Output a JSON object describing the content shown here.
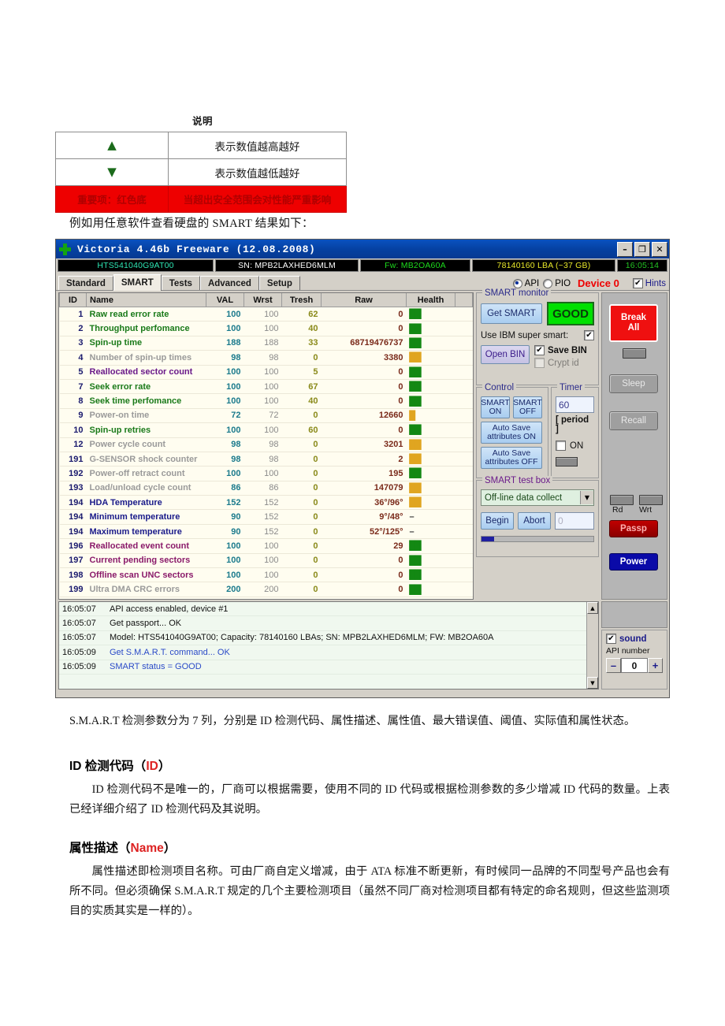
{
  "legend": {
    "title": "说明",
    "rows": [
      {
        "mark": "▲",
        "desc": "表示数值越高越好",
        "type": "up"
      },
      {
        "mark": "▼",
        "desc": "表示数值越低越好",
        "type": "down"
      },
      {
        "mark": "重要项：红色底",
        "desc": "当超出安全范围会对性能严重影响",
        "type": "warn"
      }
    ]
  },
  "intro": "例如用任意软件查看硬盘的 SMART 结果如下：",
  "victoria": {
    "title": "Victoria 4.46b Freeware (12.08.2008)",
    "window_buttons": {
      "minimize": "–",
      "maximize": "❐",
      "close": "✕"
    },
    "info": {
      "model": "HTS541040G9AT00",
      "sn": "SN: MPB2LAXHED6MLM",
      "fw": "Fw: MB2OA60A",
      "lba": "78140160 LBA (~37 GB)",
      "clock": "16:05:14"
    },
    "tabs": [
      {
        "label": "Standard",
        "active": false
      },
      {
        "label": "SMART",
        "active": true
      },
      {
        "label": "Tests",
        "active": false
      },
      {
        "label": "Advanced",
        "active": false
      },
      {
        "label": "Setup",
        "active": false
      }
    ],
    "mode": {
      "api": "API",
      "pio": "PIO",
      "api_selected": true,
      "device": "Device 0",
      "hints": "Hints",
      "hints_checked": true
    },
    "table": {
      "headers": [
        "ID",
        "Name",
        "VAL",
        "Wrst",
        "Tresh",
        "Raw",
        "Health"
      ],
      "rows": [
        {
          "id": "1",
          "name": "Raw read error rate",
          "name_color": "n-green",
          "val": "100",
          "wrst": "100",
          "tresh": "62",
          "raw": "0",
          "raw_color": "",
          "health": "▉▉",
          "health_color": "h-green"
        },
        {
          "id": "2",
          "name": "Throughput perfomance",
          "name_color": "n-green",
          "val": "100",
          "wrst": "100",
          "tresh": "40",
          "raw": "0",
          "raw_color": "",
          "health": "▉▉",
          "health_color": "h-green"
        },
        {
          "id": "3",
          "name": "Spin-up time",
          "name_color": "n-green",
          "val": "188",
          "wrst": "188",
          "tresh": "33",
          "raw": "68719476737",
          "raw_color": "",
          "health": "▉▉",
          "health_color": "h-green"
        },
        {
          "id": "4",
          "name": "Number of spin-up times",
          "name_color": "n-gray",
          "val": "98",
          "wrst": "98",
          "tresh": "0",
          "raw": "3380",
          "raw_color": "",
          "health": "▉▉",
          "health_color": "h-amber"
        },
        {
          "id": "5",
          "name": "Reallocated sector count",
          "name_color": "n-purple",
          "val": "100",
          "wrst": "100",
          "tresh": "5",
          "raw": "0",
          "raw_color": "",
          "health": "▉▉",
          "health_color": "h-green"
        },
        {
          "id": "7",
          "name": "Seek error rate",
          "name_color": "n-green",
          "val": "100",
          "wrst": "100",
          "tresh": "67",
          "raw": "0",
          "raw_color": "",
          "health": "▉▉",
          "health_color": "h-green"
        },
        {
          "id": "8",
          "name": "Seek time perfomance",
          "name_color": "n-green",
          "val": "100",
          "wrst": "100",
          "tresh": "40",
          "raw": "0",
          "raw_color": "",
          "health": "▉▉",
          "health_color": "h-green"
        },
        {
          "id": "9",
          "name": "Power-on time",
          "name_color": "n-gray",
          "val": "72",
          "wrst": "72",
          "tresh": "0",
          "raw": "12660",
          "raw_color": "",
          "health": "▉",
          "health_color": "h-amber"
        },
        {
          "id": "10",
          "name": "Spin-up retries",
          "name_color": "n-green",
          "val": "100",
          "wrst": "100",
          "tresh": "60",
          "raw": "0",
          "raw_color": "",
          "health": "▉▉",
          "health_color": "h-green"
        },
        {
          "id": "12",
          "name": "Power cycle count",
          "name_color": "n-gray",
          "val": "98",
          "wrst": "98",
          "tresh": "0",
          "raw": "3201",
          "raw_color": "",
          "health": "▉▉",
          "health_color": "h-amber"
        },
        {
          "id": "191",
          "name": "G-SENSOR shock counter",
          "name_color": "n-gray",
          "val": "98",
          "wrst": "98",
          "tresh": "0",
          "raw": "2",
          "raw_color": "",
          "health": "▉▉",
          "health_color": "h-amber"
        },
        {
          "id": "192",
          "name": "Power-off retract count",
          "name_color": "n-gray",
          "val": "100",
          "wrst": "100",
          "tresh": "0",
          "raw": "195",
          "raw_color": "",
          "health": "▉▉",
          "health_color": "h-green"
        },
        {
          "id": "193",
          "name": "Load/unload cycle count",
          "name_color": "n-gray",
          "val": "86",
          "wrst": "86",
          "tresh": "0",
          "raw": "147079",
          "raw_color": "",
          "health": "▉▉",
          "health_color": "h-amber"
        },
        {
          "id": "194",
          "name": "HDA Temperature",
          "name_color": "n-navy",
          "val": "152",
          "wrst": "152",
          "tresh": "0",
          "raw": "36°/96°",
          "raw_color": "raw-navy",
          "health": "▉▉",
          "health_color": "h-amber"
        },
        {
          "id": "194",
          "name": "Minimum temperature",
          "name_color": "n-navy",
          "val": "90",
          "wrst": "152",
          "tresh": "0",
          "raw": "9°/48°",
          "raw_color": "raw-navy",
          "health": "–",
          "health_color": "h-dash"
        },
        {
          "id": "194",
          "name": "Maximum temperature",
          "name_color": "n-navy",
          "val": "90",
          "wrst": "152",
          "tresh": "0",
          "raw": "52°/125°",
          "raw_color": "raw-navy",
          "health": "–",
          "health_color": "h-dash"
        },
        {
          "id": "196",
          "name": "Reallocated event count",
          "name_color": "n-magenta",
          "val": "100",
          "wrst": "100",
          "tresh": "0",
          "raw": "29",
          "raw_color": "raw-red",
          "health": "▉▉",
          "health_color": "h-green"
        },
        {
          "id": "197",
          "name": "Current pending sectors",
          "name_color": "n-magenta",
          "val": "100",
          "wrst": "100",
          "tresh": "0",
          "raw": "0",
          "raw_color": "",
          "health": "▉▉",
          "health_color": "h-green"
        },
        {
          "id": "198",
          "name": "Offline scan UNC sectors",
          "name_color": "n-magenta",
          "val": "100",
          "wrst": "100",
          "tresh": "0",
          "raw": "0",
          "raw_color": "",
          "health": "▉▉",
          "health_color": "h-green"
        },
        {
          "id": "199",
          "name": "Ultra DMA CRC errors",
          "name_color": "n-gray",
          "val": "200",
          "wrst": "200",
          "tresh": "0",
          "raw": "0",
          "raw_color": "",
          "health": "▉▉",
          "health_color": "h-green"
        }
      ]
    },
    "smart_monitor": {
      "legend": "SMART monitor",
      "get_smart": "Get SMART",
      "status": "GOOD",
      "use_ibm": "Use IBM super smart:",
      "use_ibm_checked": true,
      "open_bin": "Open BIN",
      "save_bin": "Save BIN",
      "save_bin_checked": true,
      "crypt_id": "Crypt id",
      "crypt_id_checked": false
    },
    "control": {
      "legend": "Control",
      "smart_on": "SMART\nON",
      "smart_off": "SMART\nOFF",
      "auto_save_on": "Auto Save\nattributes ON",
      "auto_save_off": "Auto Save\nattributes OFF"
    },
    "timer": {
      "legend": "Timer",
      "value": "60",
      "period_label": "[ period ]",
      "on_label": "ON",
      "on_checked": false
    },
    "test_box": {
      "legend": "SMART test box",
      "selected": "Off-line data collect",
      "begin": "Begin",
      "abort": "Abort",
      "count": "0",
      "progress_percent": 11
    },
    "side_buttons": {
      "break_all": "Break\nAll",
      "sleep": "Sleep",
      "recall": "Recall",
      "rd": "Rd",
      "wrt": "Wrt",
      "passp": "Passp",
      "power": "Power"
    },
    "log": [
      {
        "time": "16:05:07",
        "msg": "API access enabled, device #1",
        "blue": false
      },
      {
        "time": "16:05:07",
        "msg": "Get passport... OK",
        "blue": false
      },
      {
        "time": "16:05:07",
        "msg": "Model: HTS541040G9AT00; Capacity: 78140160 LBAs; SN: MPB2LAXHED6MLM; FW: MB2OA60A",
        "blue": false
      },
      {
        "time": "16:05:09",
        "msg": "Get S.M.A.R.T. command... OK",
        "blue": true
      },
      {
        "time": "16:05:09",
        "msg": "SMART status = GOOD",
        "blue": true
      }
    ],
    "log_panel": {
      "sound": "sound",
      "sound_checked": true,
      "api_number_label": "API number",
      "api_number_value": "0",
      "minus": "–",
      "plus": "+"
    }
  },
  "prose": {
    "p1": "S.M.A.R.T 检测参数分为 7 列，分别是 ID 检测代码、属性描述、属性值、最大错误值、阈值、实际值和属性状态。",
    "h1_prefix": "ID 检测代码（",
    "h1_accent": "ID",
    "h1_suffix": "）",
    "p2": "ID 检测代码不是唯一的，厂商可以根据需要，使用不同的 ID 代码或根据检测参数的多少增减 ID 代码的数量。上表已经详细介绍了 ID 检测代码及其说明。",
    "h2_prefix": "属性描述（",
    "h2_accent": "Name",
    "h2_suffix": "）",
    "p3": "属性描述即检测项目名称。可由厂商自定义增减，由于 ATA 标准不断更新，有时候同一品牌的不同型号产品也会有所不同。但必须确保 S.M.A.R.T 规定的几个主要检测项目（虽然不同厂商对检测项目都有特定的命名规则，但这些监测项目的实质其实是一样的）。"
  }
}
